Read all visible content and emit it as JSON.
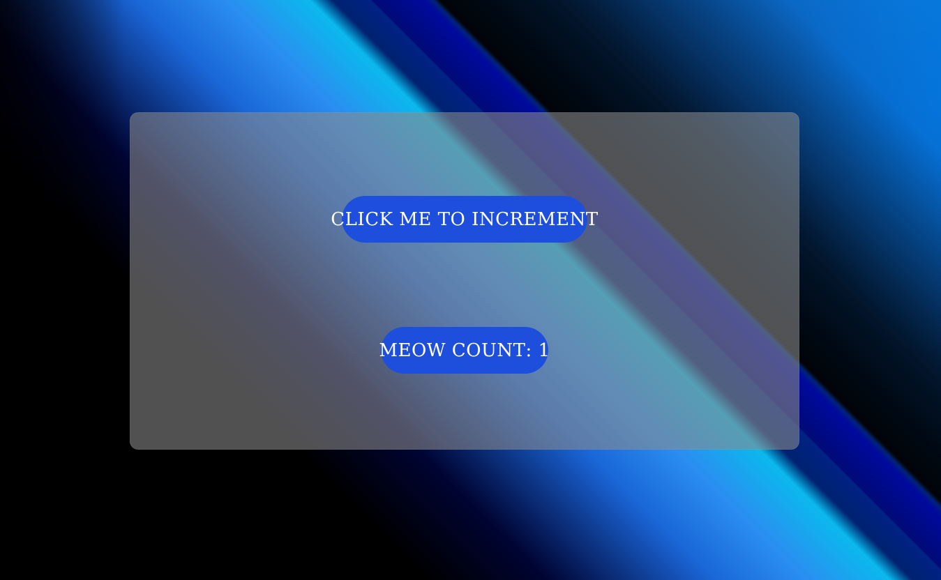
{
  "background": {
    "colors": [
      "#000000",
      "#000433",
      "#1a66d8",
      "#00ffe6",
      "#013878",
      "#0b78d8",
      "#0008a0"
    ]
  },
  "panel": {
    "increment_button": {
      "label": "Click me to increment",
      "color": "#1e4fdc"
    },
    "meow_counter": {
      "label": "Meow count",
      "separator": ": ",
      "value": "1",
      "color": "#1e4fdc"
    }
  }
}
